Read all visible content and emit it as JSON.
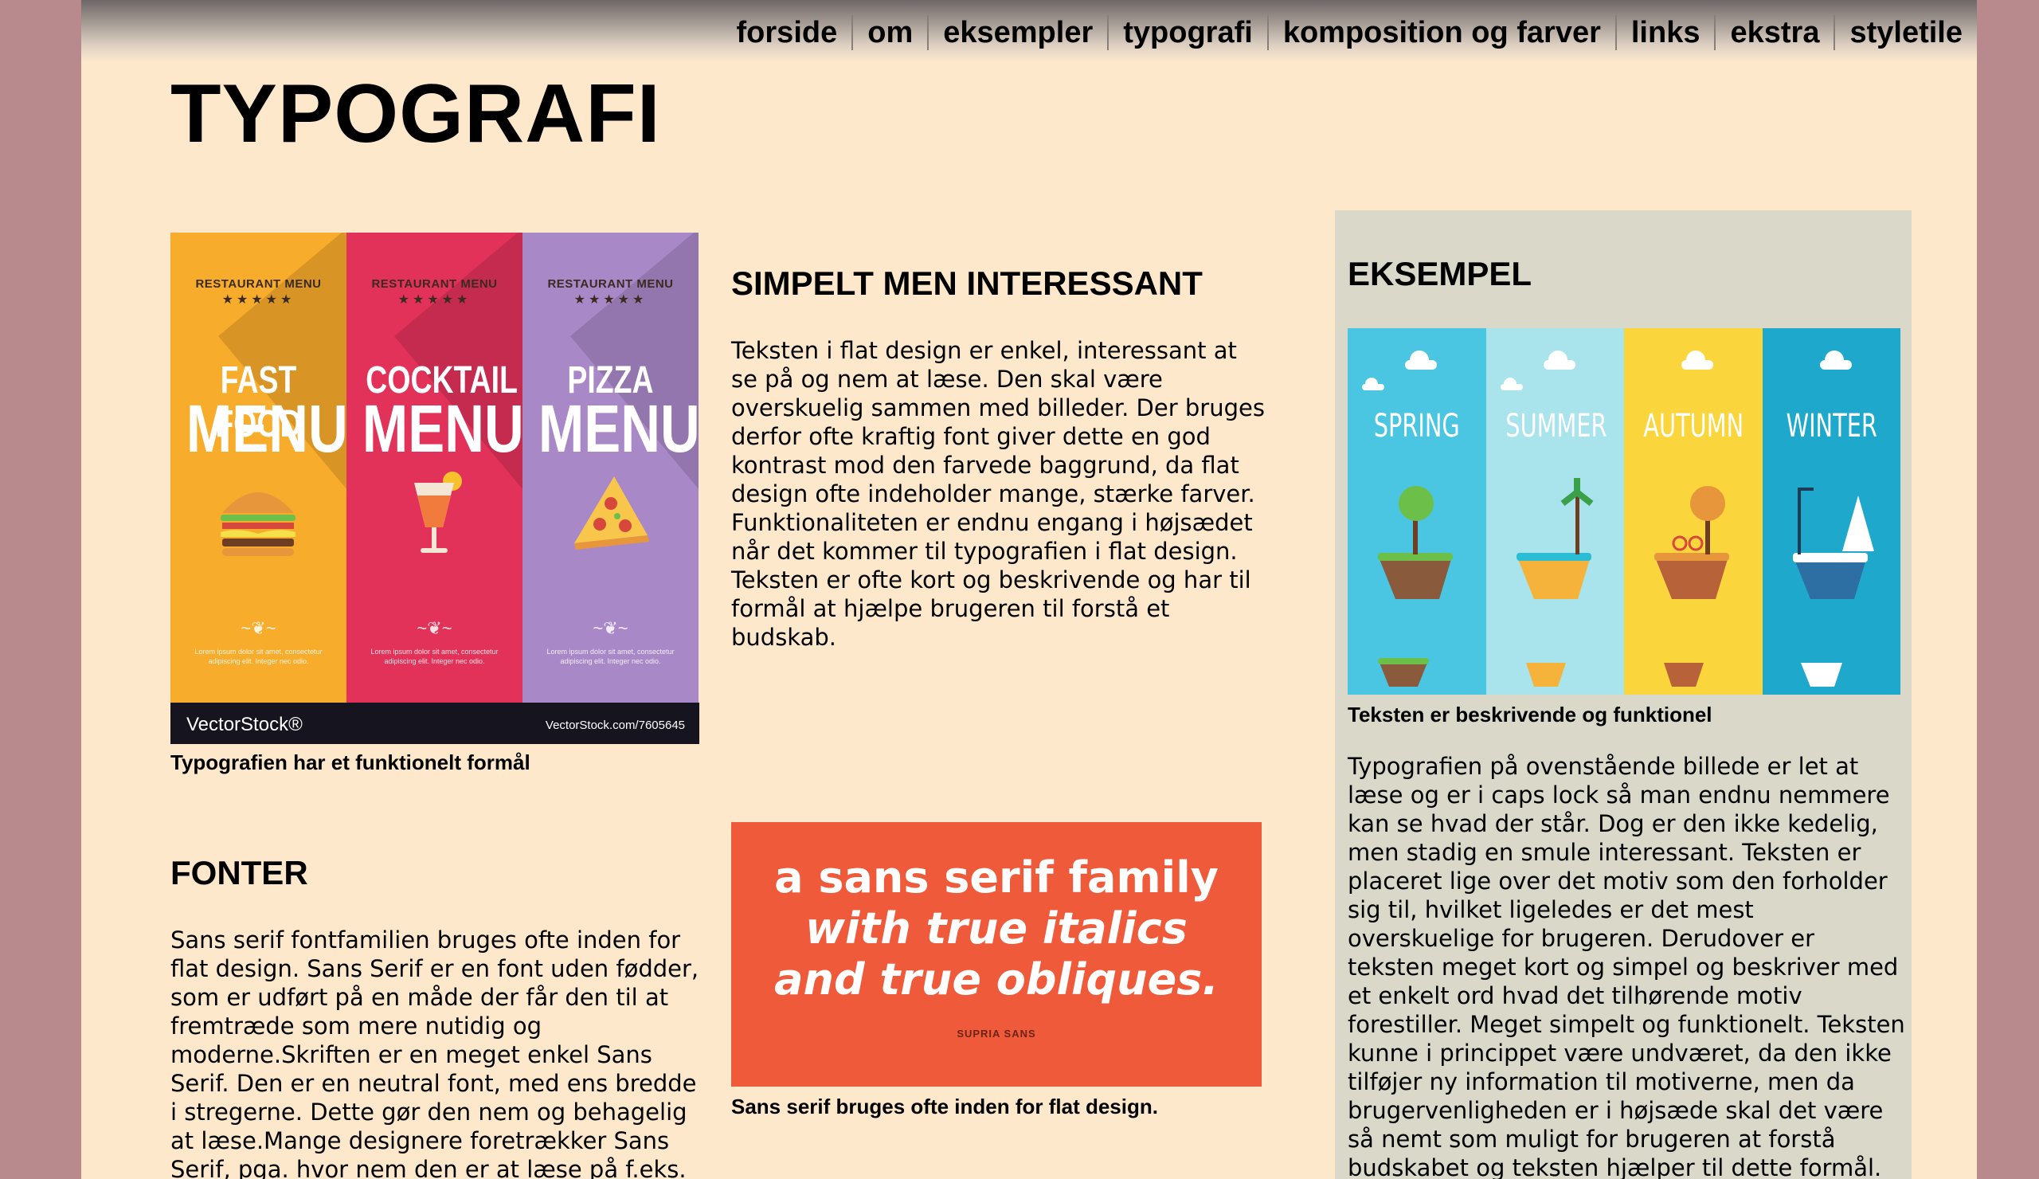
{
  "nav": {
    "items": [
      "forside",
      "om",
      "eksempler",
      "typografi",
      "komposition og farver",
      "links",
      "ekstra",
      "styletile"
    ]
  },
  "page_title": "TYPOGRAFI",
  "menu_image": {
    "panels": [
      {
        "label": "RESTAURANT MENU",
        "stars": "★★★★★",
        "line1": "FAST FOOD",
        "line2": "MENU",
        "color": "#f8ac2c",
        "fine": "Lorem ipsum dolor sit amet, consectetur adipiscing elit. Integer nec odio."
      },
      {
        "label": "RESTAURANT MENU",
        "stars": "★★★★★",
        "line1": "COCKTAIL",
        "line2": "MENU",
        "color": "#e2325a",
        "fine": "Lorem ipsum dolor sit amet, consectetur adipiscing elit. Integer nec odio."
      },
      {
        "label": "RESTAURANT MENU",
        "stars": "★★★★★",
        "line1": "PIZZA",
        "line2": "MENU",
        "color": "#a988c7",
        "fine": "Lorem ipsum dolor sit amet, consectetur adipiscing elit. Integer nec odio."
      }
    ],
    "watermark_left": "VectorStock®",
    "watermark_right": "VectorStock.com/7605645",
    "caption": "Typografien har et funktionelt formål"
  },
  "section_simpelt": {
    "heading": "SIMPELT MEN INTERESSANT",
    "text": "Teksten i flat design er enkel, interessant at se på og nem at læse. Den skal være overskuelig sammen med billeder. Der bruges derfor ofte kraftig font giver dette en god kontrast mod den farvede baggrund, da flat design ofte indeholder mange, stærke farver. Funktionaliteten er endnu engang i højsædet når det kommer til typografien i flat design. Teksten er ofte kort og beskrivende og har til formål at hjælpe brugeren til forstå et budskab."
  },
  "section_fonter": {
    "heading": "FONTER",
    "text": "Sans serif fontfamilien bruges ofte inden for flat design. Sans Serif er en font uden fødder, som er udført på en måde der får den til at fremtræde som mere nutidig og moderne.Skriften er en meget enkel Sans Serif. Den er en neutral font, med ens bredde i stregerne. Dette gør den nem og behagelig at læse.Mange designere foretrækker Sans Serif, pga. hvor nem den er at læse på f.eks. en farvet baggrund. Man ser også"
  },
  "font_image": {
    "line1": "a sans serif family",
    "line2": "with true italics",
    "line3": "and true obliques.",
    "tag": "SUPRIA SANS",
    "caption": "Sans serif bruges ofte inden for flat design."
  },
  "aside": {
    "heading": "EKSEMPEL",
    "seasons": [
      {
        "name": "SPRING",
        "color": "#4bc6e2"
      },
      {
        "name": "SUMMER",
        "color": "#a9e3ec"
      },
      {
        "name": "AUTUMN",
        "color": "#fbd53c"
      },
      {
        "name": "WINTER",
        "color": "#1ea8cc"
      }
    ],
    "caption": "Teksten er beskrivende og funktionel",
    "text": "Typografien på ovenstående billede er let at læse og er i caps lock så man endnu nemmere kan se hvad der står. Dog er den ikke kedelig, men stadig en smule interessant. Teksten er placeret lige over det motiv som den forholder sig til, hvilket ligeledes er det mest overskuelige for brugeren. Derudover er teksten meget kort og simpel og beskriver med et enkelt ord hvad det tilhørende motiv forestiller. Meget simpelt og funktionelt. Teksten kunne i princippet være undværet, da den ikke tilføjer ny information til motiverne, men da brugervenligheden er i højsæde skal det være så nemt som muligt for brugeren at forstå budskabet og teksten hjælper til dette formål."
  }
}
